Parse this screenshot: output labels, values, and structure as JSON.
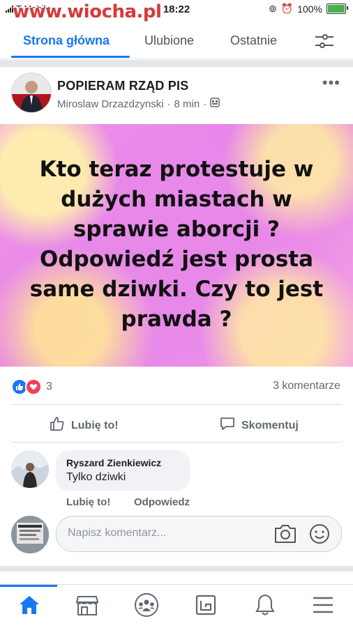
{
  "status_bar": {
    "carrier": "T-Mobile",
    "time": "18:22",
    "battery": "100%",
    "watermark": "www.wiocha.pl"
  },
  "tabs": [
    {
      "label": "Strona główna"
    },
    {
      "label": "Ulubione"
    },
    {
      "label": "Ostatnie"
    }
  ],
  "post": {
    "page_name": "POPIERAM RZĄD PIS",
    "author": "Miroslaw Drzazdzynski",
    "time": "8 min",
    "text": "Kto teraz protestuje w dużych miastach w sprawie aborcji ? Odpowiedź jest prosta same dziwki. Czy to jest prawda ?",
    "reaction_count": "3",
    "comments_count": "3 komentarze",
    "like_label": "Lubię to!",
    "comment_label": "Skomentuj"
  },
  "comment": {
    "author": "Ryszard Zienkiewicz",
    "text": "Tylko dziwki",
    "like_label": "Lubię to!",
    "reply_label": "Odpowiedz"
  },
  "composer": {
    "placeholder": "Napisz komentarz..."
  },
  "bottom_nav": {
    "items": [
      "home-icon",
      "marketplace-icon",
      "groups-icon",
      "gaming-icon",
      "notifications-icon",
      "menu-icon"
    ],
    "active_color": "#1877f2"
  }
}
